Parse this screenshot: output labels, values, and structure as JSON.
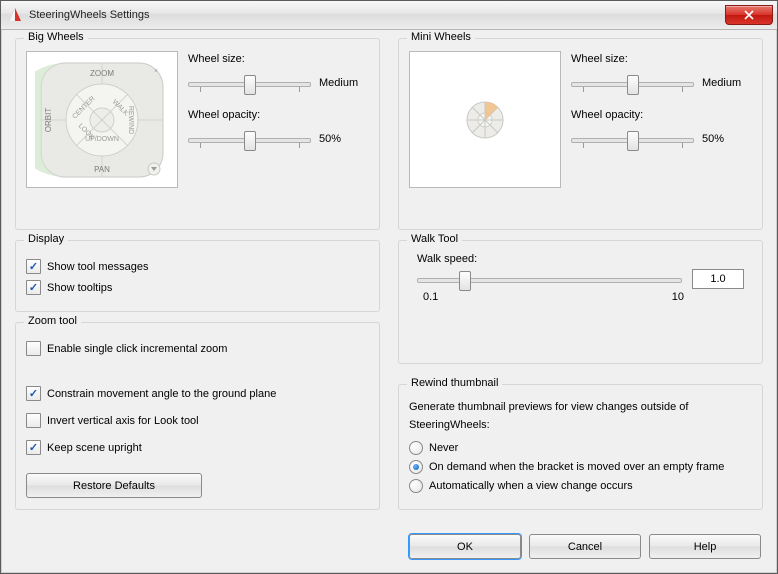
{
  "title": "SteeringWheels Settings",
  "bigWheels": {
    "legend": "Big Wheels",
    "sizeLabel": "Wheel size:",
    "sizeValue": "Medium",
    "opacityLabel": "Wheel opacity:",
    "opacityValue": "50%",
    "wheelLabels": {
      "top": "ZOOM",
      "left": "ORBIT",
      "bottom": "PAN",
      "c": "CENTER",
      "ne": "WALK",
      "e": "REWIND",
      "sw": "LOOK",
      "s": "UP/DOWN"
    }
  },
  "miniWheels": {
    "legend": "Mini Wheels",
    "sizeLabel": "Wheel size:",
    "sizeValue": "Medium",
    "opacityLabel": "Wheel opacity:",
    "opacityValue": "50%"
  },
  "display": {
    "legend": "Display",
    "showMessages": "Show tool messages",
    "showTooltips": "Show tooltips"
  },
  "zoomTool": {
    "legend": "Zoom tool",
    "singleClick": "Enable single click incremental zoom",
    "constrain": "Constrain movement angle to the ground plane",
    "invert": "Invert vertical axis for Look tool",
    "upright": "Keep scene upright",
    "restore": "Restore Defaults"
  },
  "walkTool": {
    "legend": "Walk Tool",
    "speedLabel": "Walk speed:",
    "speedValue": "1.0",
    "min": "0.1",
    "max": "10"
  },
  "rewind": {
    "legend": "Rewind thumbnail",
    "desc": "Generate thumbnail previews for view changes outside of",
    "desc2": "SteeringWheels:",
    "never": "Never",
    "onDemand": "On demand when the bracket is moved over an empty frame",
    "auto": "Automatically when a view change occurs"
  },
  "buttons": {
    "ok": "OK",
    "cancel": "Cancel",
    "help": "Help"
  }
}
